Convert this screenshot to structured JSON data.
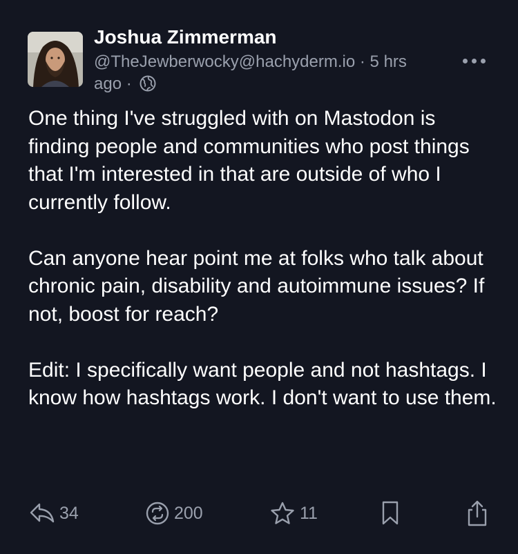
{
  "post": {
    "author": {
      "display_name": "Joshua Zimmerman",
      "handle": "@TheJewberwocky@hachyderm.io",
      "time_separator": "·",
      "relative_time": "5 hrs ago",
      "visibility_icon": "globe-icon"
    },
    "content": {
      "paragraphs": [
        "One thing I've struggled with on Mastodon is finding people and communities who post things that I'm interested in that are outside of who I currently follow.",
        "Can anyone hear point me at folks who talk about chronic pain, disability and autoimmune issues? If not, boost for reach?",
        "Edit: I specifically want people and not hashtags. I know how hashtags work. I don't want to use them."
      ]
    },
    "actions": {
      "reply": {
        "icon": "reply-icon",
        "count": "34"
      },
      "boost": {
        "icon": "boost-icon",
        "count": "200"
      },
      "favourite": {
        "icon": "star-icon",
        "count": "11"
      },
      "bookmark": {
        "icon": "bookmark-icon"
      },
      "share": {
        "icon": "share-icon"
      }
    },
    "more_icon": "more-icon"
  },
  "colors": {
    "background": "#131621",
    "text_primary": "#ffffff",
    "text_secondary": "#9aa0ad"
  }
}
